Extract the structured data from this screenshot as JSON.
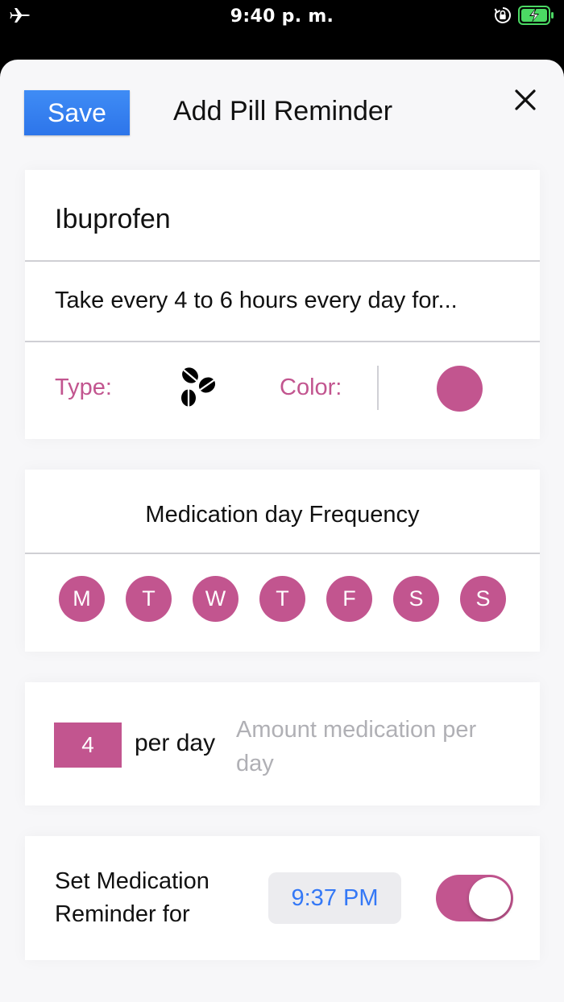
{
  "status_bar": {
    "time": "9:40 p. m.",
    "icons": [
      "airplane-icon",
      "rotation-lock-icon",
      "battery-charging-icon"
    ],
    "battery_color": "#4cd964"
  },
  "header": {
    "save_label": "Save",
    "title": "Add Pill Reminder",
    "close_icon": "close-icon"
  },
  "medication": {
    "name": "Ibuprofen",
    "description": "Take every 4 to 6 hours every day for...",
    "type_label": "Type:",
    "type_icon": "pills-icon",
    "color_label": "Color:",
    "color_value": "#c2558f"
  },
  "frequency": {
    "title": "Medication day Frequency",
    "days": [
      "M",
      "T",
      "W",
      "T",
      "F",
      "S",
      "S"
    ]
  },
  "amount": {
    "value": "4",
    "unit_label": "per day",
    "placeholder": "Amount medication per day"
  },
  "reminder": {
    "label": "Set Medication Reminder for",
    "time": "9:37 PM",
    "enabled": true
  },
  "colors": {
    "accent": "#c2558f",
    "button_blue": "#2d75ea",
    "time_text": "#3478f6"
  }
}
